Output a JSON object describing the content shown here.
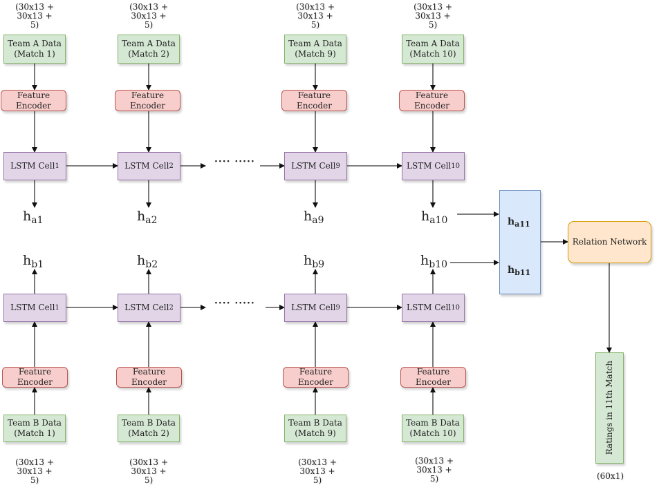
{
  "diagram": {
    "input_dim": "(30x13 + 30x13 + 5)",
    "input_dim_lines": [
      "(30x13 +",
      "30x13 +",
      "5)"
    ],
    "feature_encoder_lines": [
      "Feature",
      "Encoder"
    ],
    "lstm_label": "LSTM Cell",
    "ellipsis": "···· ·····",
    "team_a": {
      "data_boxes": [
        {
          "line1": "Team A Data",
          "line2": "(Match 1)"
        },
        {
          "line1": "Team A Data",
          "line2": "(Match 2)"
        },
        {
          "line1": "Team A Data",
          "line2": "(Match 9)"
        },
        {
          "line1": "Team A Data",
          "line2": "(Match 10)"
        }
      ],
      "lstm_subscripts": [
        "1",
        "2",
        "9",
        "10"
      ],
      "outputs": [
        {
          "base": "h",
          "sub": "a1"
        },
        {
          "base": "h",
          "sub": "a2"
        },
        {
          "base": "h",
          "sub": "a9"
        },
        {
          "base": "h",
          "sub": "a10"
        }
      ]
    },
    "team_b": {
      "data_boxes": [
        {
          "line1": "Team B Data",
          "line2": "(Match 1)"
        },
        {
          "line1": "Team B Data",
          "line2": "(Match 2)"
        },
        {
          "line1": "Team B Data",
          "line2": "(Match 9)"
        },
        {
          "line1": "Team B Data",
          "line2": "(Match 10)"
        }
      ],
      "lstm_subscripts": [
        "1",
        "2",
        "9",
        "10"
      ],
      "outputs": [
        {
          "base": "h",
          "sub": "b1"
        },
        {
          "base": "h",
          "sub": "b2"
        },
        {
          "base": "h",
          "sub": "b9"
        },
        {
          "base": "h",
          "sub": "b10"
        }
      ]
    },
    "concat": {
      "top": {
        "base": "h",
        "sub": "a11"
      },
      "bottom": {
        "base": "h",
        "sub": "b11"
      }
    },
    "relation_network": "Relation Network",
    "ratings": "Ratings in 11th Match",
    "output_dim": "(60x1)"
  }
}
